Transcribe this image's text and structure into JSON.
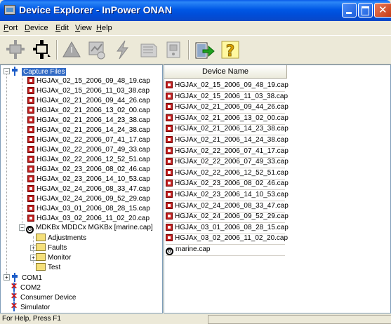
{
  "window": {
    "title": "Device Explorer - InPower ONAN"
  },
  "menu": [
    {
      "accel": "P",
      "rest": "ort"
    },
    {
      "accel": "D",
      "rest": "evice"
    },
    {
      "accel": "E",
      "rest": "dit"
    },
    {
      "accel": "V",
      "rest": "iew"
    },
    {
      "accel": "H",
      "rest": "elp"
    }
  ],
  "toolbar_icons": [
    "connect-icon",
    "disconnect-icon",
    "warning-icon",
    "monitor-icon",
    "flash-icon",
    "calibrate-icon",
    "device-icon",
    "export-icon",
    "help-icon"
  ],
  "tree": {
    "root_label": "Capture Files",
    "files": [
      "HGJAx_02_15_2006_09_48_19.cap",
      "HGJAx_02_15_2006_11_03_38.cap",
      "HGJAx_02_21_2006_09_44_26.cap",
      "HGJAx_02_21_2006_13_02_00.cap",
      "HGJAx_02_21_2006_14_23_38.cap",
      "HGJAx_02_21_2006_14_24_38.cap",
      "HGJAx_02_22_2006_07_41_17.cap",
      "HGJAx_02_22_2006_07_49_33.cap",
      "HGJAx_02_22_2006_12_52_51.cap",
      "HGJAx_02_23_2006_08_02_46.cap",
      "HGJAx_02_23_2006_14_10_53.cap",
      "HGJAx_02_24_2006_08_33_47.cap",
      "HGJAx_02_24_2006_09_52_29.cap",
      "HGJAx_03_01_2006_08_28_15.cap",
      "HGJAx_03_02_2006_11_02_20.cap"
    ],
    "marine_label": "MDKBx MDDCx MGKBx [marine.cap]",
    "marine_children": [
      "Adjustments",
      "Faults",
      "Monitor",
      "Test"
    ],
    "ports": [
      "COM1",
      "COM2",
      "Consumer Device",
      "Simulator"
    ]
  },
  "list": {
    "header": "Device Name",
    "items": [
      "HGJAx_02_15_2006_09_48_19.cap",
      "HGJAx_02_15_2006_11_03_38.cap",
      "HGJAx_02_21_2006_09_44_26.cap",
      "HGJAx_02_21_2006_13_02_00.cap",
      "HGJAx_02_21_2006_14_23_38.cap",
      "HGJAx_02_21_2006_14_24_38.cap",
      "HGJAx_02_22_2006_07_41_17.cap",
      "HGJAx_02_22_2006_07_49_33.cap",
      "HGJAx_02_22_2006_12_52_51.cap",
      "HGJAx_02_23_2006_08_02_46.cap",
      "HGJAx_02_23_2006_14_10_53.cap",
      "HGJAx_02_24_2006_08_33_47.cap",
      "HGJAx_02_24_2006_09_52_29.cap",
      "HGJAx_03_01_2006_08_28_15.cap",
      "HGJAx_03_02_2006_11_02_20.cap"
    ],
    "last_item": "marine.cap"
  },
  "status": {
    "text": "For Help, Press F1"
  }
}
